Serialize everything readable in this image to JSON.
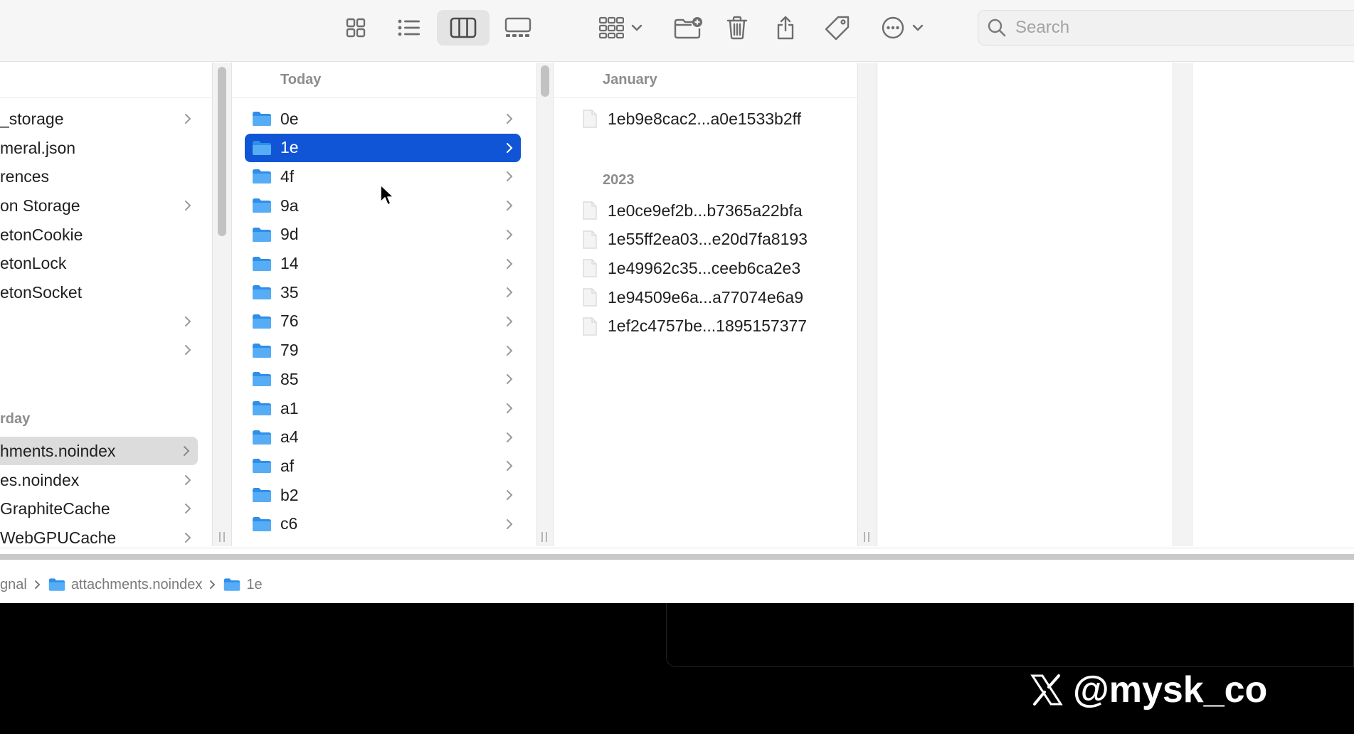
{
  "toolbar": {
    "buttons": [
      {
        "name": "icon-view-button",
        "icon": "grid-icon",
        "active": false
      },
      {
        "name": "list-view-button",
        "icon": "list-icon",
        "active": false
      },
      {
        "name": "column-view-button",
        "icon": "columns-icon",
        "active": true
      },
      {
        "name": "gallery-view-button",
        "icon": "gallery-icon",
        "active": false
      },
      {
        "name": "group-button",
        "icon": "group-icon",
        "active": false
      },
      {
        "name": "new-folder-button",
        "icon": "new-folder-icon",
        "active": false
      },
      {
        "name": "trash-button",
        "icon": "trash-icon",
        "active": false
      },
      {
        "name": "share-button",
        "icon": "share-icon",
        "active": false
      },
      {
        "name": "tag-button",
        "icon": "tag-icon",
        "active": false
      },
      {
        "name": "more-button",
        "icon": "ellipsis-circle-icon",
        "active": false
      }
    ],
    "search": {
      "placeholder": "Search",
      "value": ""
    }
  },
  "column1": {
    "items": [
      {
        "label": "_storage",
        "has_children": true
      },
      {
        "label": "meral.json",
        "has_children": false
      },
      {
        "label": "rences",
        "has_children": false
      },
      {
        "label": "on Storage",
        "has_children": true
      },
      {
        "label": "etonCookie",
        "has_children": false
      },
      {
        "label": "etonLock",
        "has_children": false
      },
      {
        "label": "etonSocket",
        "has_children": false
      },
      {
        "label": "",
        "has_children": true
      },
      {
        "label": "",
        "has_children": true
      }
    ],
    "section": "rday",
    "section_items": [
      {
        "label": "hments.noindex",
        "has_children": true,
        "highlighted": true
      },
      {
        "label": "es.noindex",
        "has_children": true
      },
      {
        "label": "GraphiteCache",
        "has_children": true
      },
      {
        "label": "WebGPUCache",
        "has_children": true
      }
    ]
  },
  "column2": {
    "header": "Today",
    "folders": [
      "0e",
      "1e",
      "4f",
      "9a",
      "9d",
      "14",
      "35",
      "76",
      "79",
      "85",
      "a1",
      "a4",
      "af",
      "b2",
      "c6"
    ],
    "selected": "1e"
  },
  "column3": {
    "header": "January",
    "january_files": [
      "1eb9e8cac2...a0e1533b2ff"
    ],
    "section2": "2023",
    "files_2023": [
      "1e0ce9ef2b...b7365a22bfa",
      "1e55ff2ea03...e20d7fa8193",
      "1e49962c35...ceeb6ca2e3",
      "1e94509e6a...a77074e6a9",
      "1ef2c4757be...1895157377"
    ]
  },
  "pathbar": {
    "crumbs": [
      {
        "label": "gnal",
        "folder": false
      },
      {
        "label": "attachments.noindex",
        "folder": true
      },
      {
        "label": "1e",
        "folder": true
      }
    ]
  },
  "watermark": {
    "handle": "@mysk_co",
    "icon": "x-logo-icon"
  },
  "colors": {
    "selection": "#1055d6",
    "folder": "#3a9cf0",
    "highlight": "#dcdcdc"
  }
}
